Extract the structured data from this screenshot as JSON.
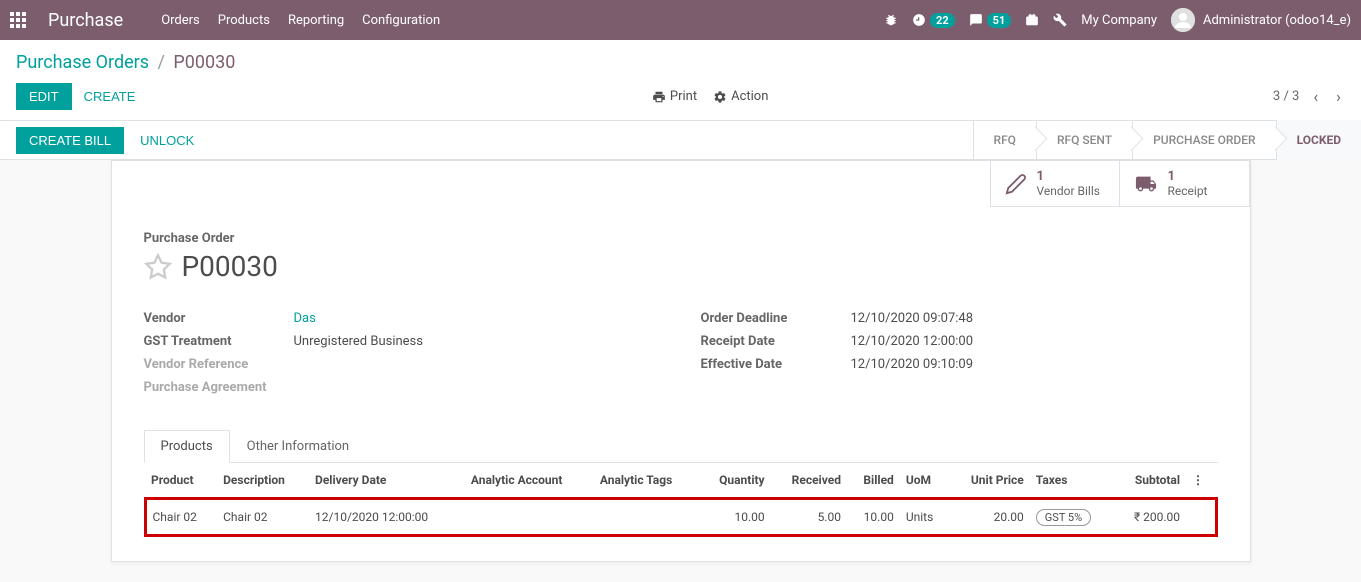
{
  "navbar": {
    "app_title": "Purchase",
    "menu": [
      "Orders",
      "Products",
      "Reporting",
      "Configuration"
    ],
    "clock_badge": "22",
    "chat_badge": "51",
    "company": "My Company",
    "user": "Administrator (odoo14_e)"
  },
  "breadcrumb": {
    "parent": "Purchase Orders",
    "current": "P00030"
  },
  "buttons": {
    "edit": "EDIT",
    "create": "CREATE",
    "print": "Print",
    "action": "Action",
    "create_bill": "CREATE BILL",
    "unlock": "UNLOCK"
  },
  "pager": {
    "text": "3 / 3"
  },
  "status_steps": [
    "RFQ",
    "RFQ SENT",
    "PURCHASE ORDER",
    "LOCKED"
  ],
  "stat_buttons": {
    "vendor_bills_count": "1",
    "vendor_bills_label": "Vendor Bills",
    "receipt_count": "1",
    "receipt_label": "Receipt"
  },
  "form": {
    "title_label": "Purchase Order",
    "order_name": "P00030",
    "left_fields": [
      {
        "label": "Vendor",
        "value": "Das",
        "link": true
      },
      {
        "label": "GST Treatment",
        "value": "Unregistered Business"
      },
      {
        "label": "Vendor Reference",
        "value": "",
        "muted": true
      },
      {
        "label": "Purchase Agreement",
        "value": "",
        "muted": true
      }
    ],
    "right_fields": [
      {
        "label": "Order Deadline",
        "value": "12/10/2020 09:07:48"
      },
      {
        "label": "Receipt Date",
        "value": "12/10/2020 12:00:00"
      },
      {
        "label": "Effective Date",
        "value": "12/10/2020 09:10:09"
      }
    ]
  },
  "tabs": [
    "Products",
    "Other Information"
  ],
  "table": {
    "headers": [
      "Product",
      "Description",
      "Delivery Date",
      "Analytic Account",
      "Analytic Tags",
      "Quantity",
      "Received",
      "Billed",
      "UoM",
      "Unit Price",
      "Taxes",
      "Subtotal"
    ],
    "rows": [
      {
        "product": "Chair 02",
        "description": "Chair 02",
        "delivery_date": "12/10/2020 12:00:00",
        "analytic_account": "",
        "analytic_tags": "",
        "quantity": "10.00",
        "received": "5.00",
        "billed": "10.00",
        "uom": "Units",
        "unit_price": "20.00",
        "taxes": "GST 5%",
        "subtotal": "₹ 200.00"
      }
    ]
  }
}
